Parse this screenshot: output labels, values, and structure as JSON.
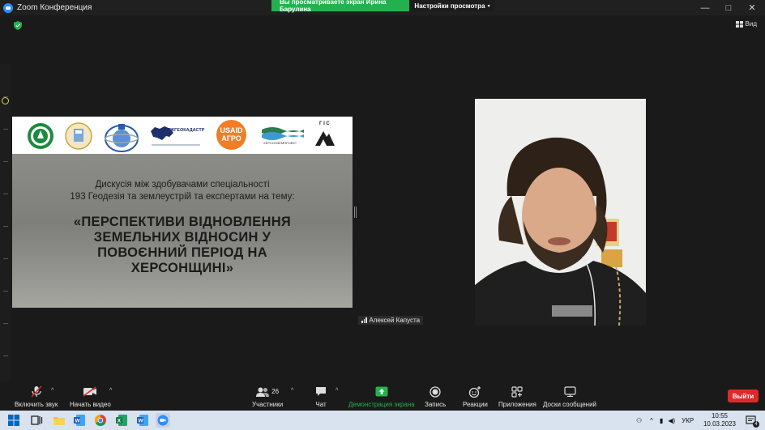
{
  "window": {
    "title": "Zoom Конференция",
    "controls": [
      "—",
      "□",
      "✕"
    ]
  },
  "share_banner": {
    "info": "Вы просматриваете экран Ирина Барулина",
    "settings_label": "Настройки просмотра"
  },
  "view_button": "Вид",
  "slide": {
    "subtitle_line1": "Дискусія між здобувачами спеціальності",
    "subtitle_line2": "193 Геодезія та землеустрій та експертами на тему:",
    "heading_lines": [
      "«ПЕРСПЕКТИВИ ВІДНОВЛЕННЯ",
      "ЗЕМЕЛЬНИХ ВІДНОСИН У",
      "ПОВОЄННИЙ ПЕРІОД НА",
      "ХЕРСОНЩИНІ»"
    ],
    "logos": {
      "derzh_geokadastr": "ДЕРЖГЕОКАДАСТР",
      "usaid_line1": "USAID",
      "usaid_line2": "АГРО",
      "khersonzemproekt": "ХЕРСОНЗЕМПРОЕКТ",
      "gis": "Г І С"
    },
    "colors": {
      "usaid": "#f07e26",
      "green_seal": "#1d8a3e"
    }
  },
  "participant": {
    "name": "Алексей Капуста"
  },
  "toolbar": {
    "audio_label": "Включить звук",
    "video_label": "Начать видео",
    "participants_label": "Участники",
    "participants_count": "26",
    "chat_label": "Чат",
    "share_label": "Демонстрация экрана",
    "record_label": "Запись",
    "reactions_label": "Реакции",
    "apps_label": "Приложения",
    "whiteboard_label": "Доски сообщений",
    "leave_label": "Выйти"
  },
  "taskbar": {
    "lang": "УКР",
    "time": "10:55",
    "date": "10.03.2023",
    "notifications_count": "4",
    "apps": [
      "windows-start",
      "task-view",
      "file-explorer",
      "word",
      "chrome",
      "excel",
      "word",
      "zoom"
    ]
  }
}
